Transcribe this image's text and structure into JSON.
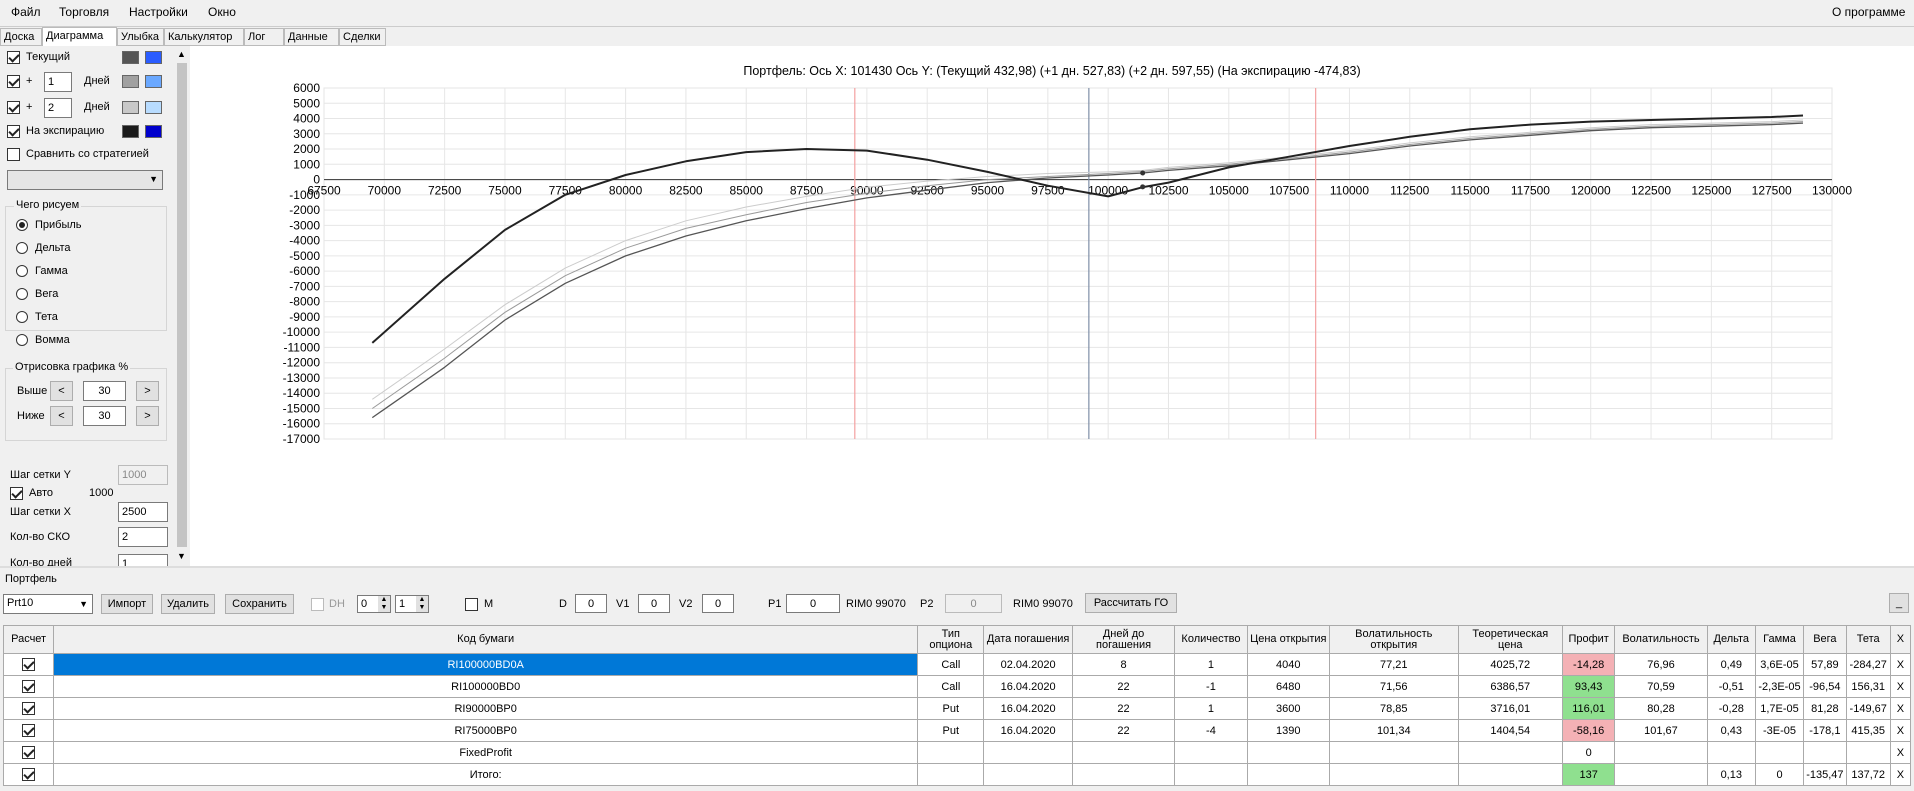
{
  "menu": {
    "file": "Файл",
    "trade": "Торговля",
    "settings": "Настройки",
    "window": "Окно",
    "about": "О программе"
  },
  "tabs": [
    "Доска",
    "Диаграмма",
    "Улыбка",
    "Калькулятор",
    "Лог",
    "Данные",
    "Сделки"
  ],
  "left": {
    "current_label": "Текущий",
    "plus": "+",
    "days_label": "Дней",
    "days1": "1",
    "days2": "2",
    "expiration_label": "На экспирацию",
    "compare_label": "Сравнить со стратегией",
    "draw_group": "Чего рисуем",
    "radios": [
      "Прибыль",
      "Дельта",
      "Гамма",
      "Вега",
      "Тета",
      "Вомма"
    ],
    "render_group": "Отрисовка графика %",
    "above_label": "Выше",
    "below_label": "Ниже",
    "above_value": "30",
    "below_value": "30",
    "lt": "<",
    "gt": ">",
    "grid_y_label": "Шаг сетки Y",
    "grid_y_value": "1000",
    "auto_label": "Авто",
    "auto_value": "1000",
    "grid_x_label": "Шаг сетки X",
    "grid_x_value": "2500",
    "sko_label": "Кол-во СКО",
    "sko_value": "2",
    "days_count_label": "Кол-во дней",
    "days_count_value": "1",
    "colors": {
      "current": [
        "#555555",
        "#2a5cff"
      ],
      "d1": [
        "#a0a0a0",
        "#6aa8ff"
      ],
      "d2": [
        "#c8c8c8",
        "#b8dcff"
      ],
      "exp": [
        "#1a1a1a",
        "#0000cc"
      ]
    }
  },
  "chart_header": "Портфель: Ось X: 101430 Ось Y:  (Текущий 432,98)  (+1 дн. 527,83)  (+2 дн. 597,55)  (На экспирацию -474,83)",
  "chart_data": {
    "type": "line",
    "xlim": [
      67500,
      130000
    ],
    "ylim": [
      -17000,
      6000
    ],
    "x_ticks": [
      "67500",
      "70000",
      "72500",
      "75000",
      "77500",
      "80000",
      "82500",
      "85000",
      "87500",
      "90000",
      "92500",
      "95000",
      "97500",
      "100000",
      "102500",
      "105000",
      "107500",
      "110000",
      "112500",
      "115000",
      "117500",
      "120000",
      "122500",
      "125000",
      "127500",
      "130000"
    ],
    "y_ticks": [
      "6000",
      "5000",
      "4000",
      "3000",
      "2000",
      "1000",
      "0",
      "-1000",
      "-2000",
      "-3000",
      "-4000",
      "-5000",
      "-6000",
      "-7000",
      "-8000",
      "-9000",
      "-10000",
      "-11000",
      "-12000",
      "-13000",
      "-14000",
      "-15000",
      "-16000",
      "-17000"
    ],
    "vlines": [
      {
        "x": 89500,
        "color": "#f4a0a0"
      },
      {
        "x": 99200,
        "color": "#8090a8"
      },
      {
        "x": 108600,
        "color": "#f4a0a0"
      }
    ],
    "series": [
      {
        "color": "#222222",
        "width": 2,
        "x": [
          69500,
          72500,
          75000,
          77500,
          80000,
          82500,
          85000,
          87500,
          90000,
          92500,
          95000,
          97500,
          100000,
          101430,
          102500,
          105000,
          107500,
          110000,
          112500,
          115000,
          117500,
          120000,
          122500,
          125000,
          127500,
          128800
        ],
        "y": [
          -10700,
          -6500,
          -3300,
          -1000,
          300,
          1200,
          1800,
          2000,
          1900,
          1300,
          500,
          -400,
          -1100,
          -500,
          -200,
          800,
          1500,
          2200,
          2800,
          3300,
          3600,
          3800,
          3900,
          4000,
          4100,
          4200
        ]
      },
      {
        "color": "#555555",
        "width": 1.3,
        "x": [
          69500,
          72500,
          75000,
          77500,
          80000,
          82500,
          85000,
          87500,
          90000,
          92500,
          95000,
          97500,
          100000,
          101430,
          102500,
          105000,
          107500,
          110000,
          112500,
          115000,
          117500,
          120000,
          122500,
          125000,
          127500,
          128800
        ],
        "y": [
          -15600,
          -12300,
          -9200,
          -6800,
          -5000,
          -3700,
          -2700,
          -1900,
          -1200,
          -700,
          -200,
          100,
          300,
          433,
          600,
          900,
          1300,
          1700,
          2200,
          2600,
          2900,
          3200,
          3400,
          3500,
          3600,
          3700
        ]
      },
      {
        "color": "#9a9a9a",
        "width": 1,
        "x": [
          69500,
          72500,
          75000,
          77500,
          80000,
          82500,
          85000,
          87500,
          90000,
          92500,
          95000,
          97500,
          100000,
          101430,
          102500,
          105000,
          107500,
          110000,
          112500,
          115000,
          117500,
          120000,
          122500,
          125000,
          127500,
          128800
        ],
        "y": [
          -15000,
          -11700,
          -8700,
          -6300,
          -4500,
          -3200,
          -2300,
          -1500,
          -900,
          -400,
          0,
          200,
          400,
          528,
          700,
          1000,
          1400,
          1800,
          2300,
          2700,
          3000,
          3300,
          3500,
          3600,
          3700,
          3800
        ]
      },
      {
        "color": "#cccccc",
        "width": 1,
        "x": [
          69500,
          72500,
          75000,
          77500,
          80000,
          82500,
          85000,
          87500,
          90000,
          92500,
          95000,
          97500,
          100000,
          101430,
          102500,
          105000,
          107500,
          110000,
          112500,
          115000,
          117500,
          120000,
          122500,
          125000,
          127500,
          128800
        ],
        "y": [
          -14400,
          -11100,
          -8200,
          -5800,
          -4000,
          -2700,
          -1800,
          -1100,
          -500,
          -100,
          200,
          400,
          500,
          598,
          800,
          1100,
          1500,
          1900,
          2400,
          2800,
          3100,
          3400,
          3600,
          3700,
          3800,
          3900
        ]
      }
    ],
    "markers": [
      {
        "x": 101430,
        "y": 433
      },
      {
        "x": 101430,
        "y": -475
      }
    ]
  },
  "portfolio_label": "Портфель",
  "toolbar": {
    "portfolio_select": "Prt10",
    "import": "Импорт",
    "delete": "Удалить",
    "save": "Сохранить",
    "dh": "DH",
    "s0": "0",
    "s1": "1",
    "m": "M",
    "d_label": "D",
    "d_val": "0",
    "v1_label": "V1",
    "v1_val": "0",
    "v2_label": "V2",
    "v2_val": "0",
    "p1_label": "P1",
    "p1_val": "0",
    "rim1": "RIM0 99070",
    "p2_label": "P2",
    "p2_val": "0",
    "rim2": "RIM0 99070",
    "calc_go": "Рассчитать ГО",
    "minimize": "_"
  },
  "table": {
    "headers": [
      "Расчет",
      "Код бумаги",
      "Тип опциона",
      "Дата погашения",
      "Дней до погашения",
      "Количество",
      "Цена открытия",
      "Волатильность открытия",
      "Теоретическая цена",
      "Профит",
      "Волатильность",
      "Дельта",
      "Гамма",
      "Вега",
      "Тета",
      "X"
    ],
    "rows": [
      [
        "RI100000BD0A",
        "Call",
        "02.04.2020",
        "8",
        "1",
        "4040",
        "77,21",
        "4025,72",
        "-14,28",
        "76,96",
        "0,49",
        "3,6E-05",
        "57,89",
        "-284,27",
        "X"
      ],
      [
        "RI100000BD0",
        "Call",
        "16.04.2020",
        "22",
        "-1",
        "6480",
        "71,56",
        "6386,57",
        "93,43",
        "70,59",
        "-0,51",
        "-2,3E-05",
        "-96,54",
        "156,31",
        "X"
      ],
      [
        "RI90000BP0",
        "Put",
        "16.04.2020",
        "22",
        "1",
        "3600",
        "78,85",
        "3716,01",
        "116,01",
        "80,28",
        "-0,28",
        "1,7E-05",
        "81,28",
        "-149,67",
        "X"
      ],
      [
        "RI75000BP0",
        "Put",
        "16.04.2020",
        "22",
        "-4",
        "1390",
        "101,34",
        "1404,54",
        "-58,16",
        "101,67",
        "0,43",
        "-3E-05",
        "-178,1",
        "415,35",
        "X"
      ],
      [
        "FixedProfit",
        "",
        "",
        "",
        "",
        "",
        "",
        "",
        "0",
        "",
        "",
        "",
        "",
        "",
        "X"
      ],
      [
        "Итого:",
        "",
        "",
        "",
        "",
        "",
        "",
        "",
        "137",
        "",
        "0,13",
        "0",
        "-135,47",
        "137,72",
        "X"
      ]
    ]
  }
}
